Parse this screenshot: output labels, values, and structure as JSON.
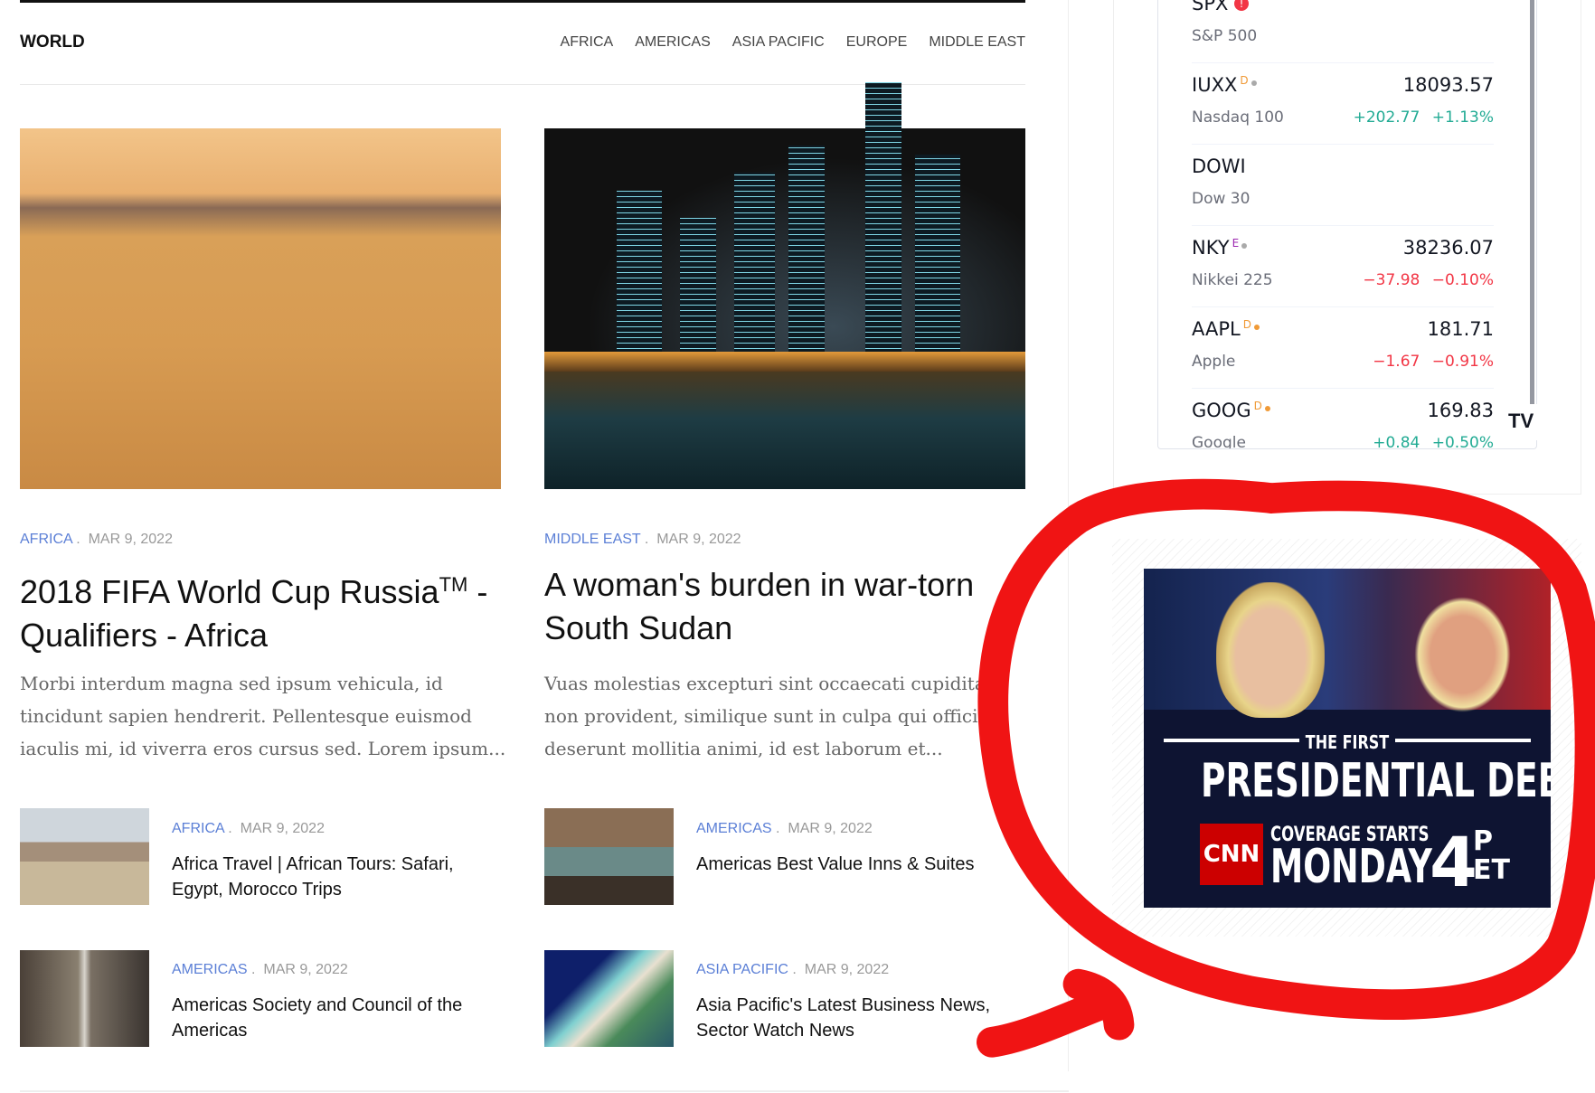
{
  "section": {
    "title": "WORLD",
    "nav": [
      "AFRICA",
      "AMERICAS",
      "ASIA PACIFIC",
      "EUROPE",
      "MIDDLE EAST"
    ]
  },
  "featured": [
    {
      "category": "AFRICA",
      "date": "MAR 9, 2022",
      "title": "2018 FIFA World Cup Russia",
      "title_sup": "TM",
      "title_rest": " - Qualifiers - Africa",
      "excerpt": "Morbi interdum magna sed ipsum vehicula, id tincidunt sapien hendrerit. Pellentesque euismod iaculis mi, id viverra eros cursus sed. Lorem ipsum..."
    },
    {
      "category": "MIDDLE EAST",
      "date": "MAR 9, 2022",
      "title": "A woman's burden in war-torn South Sudan",
      "excerpt": "Vuas molestias excepturi sint occaecati cupiditate non provident, similique sunt in culpa qui officia deserunt mollitia animi, id est laborum et..."
    }
  ],
  "small": [
    {
      "category": "AFRICA",
      "date": "MAR 9, 2022",
      "title": "Africa Travel | African Tours: Safari, Egypt, Morocco Trips"
    },
    {
      "category": "AMERICAS",
      "date": "MAR 9, 2022",
      "title": "Americas Best Value Inns & Suites"
    },
    {
      "category": "AMERICAS",
      "date": "MAR 9, 2022",
      "title": "Americas Society and Council of the Americas"
    },
    {
      "category": "ASIA PACIFIC",
      "date": "MAR 9, 2022",
      "title": "Asia Pacific's Latest Business News, Sector Watch News"
    }
  ],
  "ticker": [
    {
      "symbol": "SPX",
      "badge": "!",
      "name": "S&P 500",
      "price": "",
      "change": "",
      "pct": ""
    },
    {
      "symbol": "IUXX",
      "badge": "D",
      "name": "Nasdaq 100",
      "price": "18093.57",
      "change": "+202.77",
      "pct": "+1.13%"
    },
    {
      "symbol": "DOWI",
      "badge": "",
      "name": "Dow 30",
      "price": "",
      "change": "",
      "pct": ""
    },
    {
      "symbol": "NKY",
      "badge": "E",
      "name": "Nikkei 225",
      "price": "38236.07",
      "change": "−37.98",
      "pct": "−0.10%"
    },
    {
      "symbol": "AAPL",
      "badge": "D",
      "name": "Apple",
      "price": "181.71",
      "change": "−1.67",
      "pct": "−0.91%"
    },
    {
      "symbol": "GOOG",
      "badge": "D",
      "name": "Google",
      "price": "169.83",
      "change": "+0.84",
      "pct": "+0.50%"
    }
  ],
  "ticker_logo": "TV",
  "ad": {
    "line1": "THE FIRST",
    "line2": "PRESIDENTIAL DEBATE",
    "network": "CNN",
    "line3": "COVERAGE STARTS",
    "day": "MONDAY",
    "hour": "4",
    "ampm": "P",
    "tz": "ET"
  },
  "colors": {
    "accent": "#5b7fd6",
    "up": "#22ab94",
    "down": "#f23645",
    "annotation": "#f01414"
  }
}
